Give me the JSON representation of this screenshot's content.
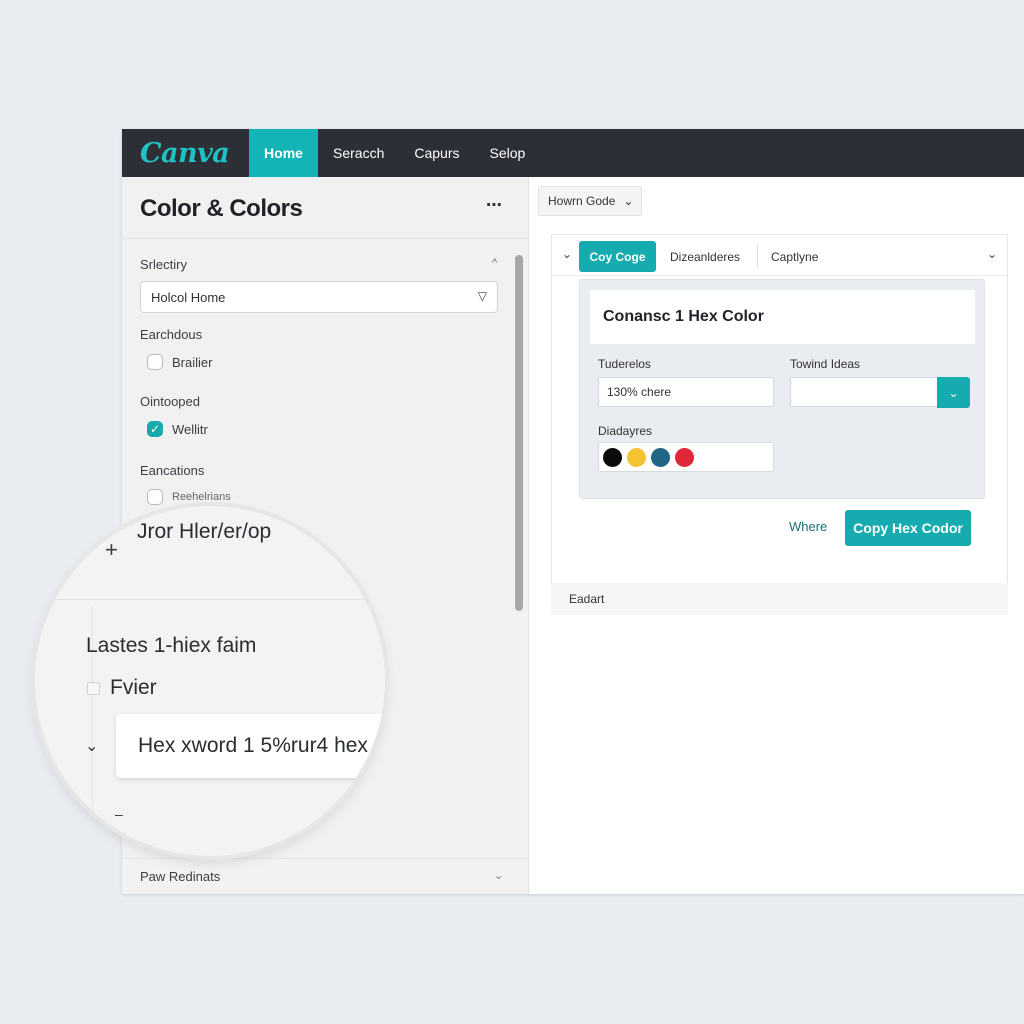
{
  "topbar": {
    "logo": "Canva",
    "nav": [
      {
        "label": "Home",
        "active": true
      },
      {
        "label": "Seracch",
        "active": false
      },
      {
        "label": "Capurs",
        "active": false
      },
      {
        "label": "Selop",
        "active": false
      }
    ]
  },
  "left_panel": {
    "title": "Color & Colors",
    "more_icon": "⋯",
    "sections": {
      "selectiry": {
        "label": "Srlectiry",
        "collapse_icon": "^"
      },
      "select": {
        "value": "Holcol Home",
        "caret": "▽"
      },
      "earchdous": {
        "label": "Earchdous",
        "option": {
          "label": "Brailier",
          "checked": false
        }
      },
      "ointooped": {
        "label": "Ointooped",
        "option": {
          "label": "Wellitr",
          "checked": true
        }
      },
      "eancations": {
        "label": "Eancations",
        "option": {
          "label": "Reehelrians",
          "checked": false
        }
      }
    },
    "footer": {
      "label": "Paw Redinats",
      "caret": "⌄"
    }
  },
  "magnifier": {
    "top_text": "Jror Hler/er/op",
    "plus": "+",
    "label": "Lastes 1-hiex faim",
    "check_label": "Fvier",
    "input_value": "Hex xword 1 5%rur4 hex",
    "chevron": "⌄",
    "minus": "–"
  },
  "right_area": {
    "mode_button": {
      "label": "Howrn Gode",
      "caret": "⌄"
    },
    "tabs": [
      {
        "label": "Coy Coge",
        "active": true
      },
      {
        "label": "Dizeanlderes",
        "active": false
      },
      {
        "label": "Captlyne",
        "active": false
      }
    ],
    "panel": {
      "title": "Conansc 1 Hex Color",
      "field1": {
        "label": "Tuderelos",
        "value": "130% chere"
      },
      "field2": {
        "label": "Towind Ideas",
        "value": ""
      },
      "swatches_label": "Diadayres",
      "swatches": [
        "#0b0b0b",
        "#f4c430",
        "#1f6784",
        "#e3273b"
      ]
    },
    "link_label": "Where",
    "primary_button": "Copy Hex Codor",
    "footer_label": "Eadart"
  },
  "colors": {
    "accent": "#16abae",
    "topbar_bg": "#2c2f36",
    "logo": "#1fc2c2"
  }
}
